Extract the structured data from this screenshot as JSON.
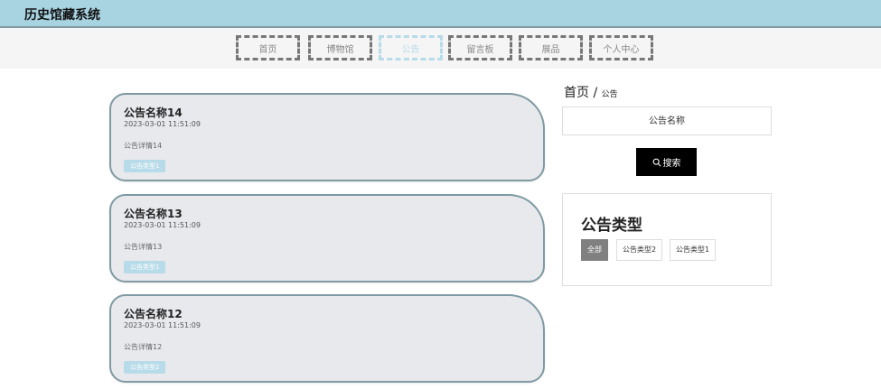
{
  "app": {
    "title": "历史馆藏系统"
  },
  "nav": {
    "items": [
      {
        "label": "首页",
        "active": false
      },
      {
        "label": "博物馆",
        "active": false
      },
      {
        "label": "公告",
        "active": true
      },
      {
        "label": "留言板",
        "active": false
      },
      {
        "label": "展品",
        "active": false
      },
      {
        "label": "个人中心",
        "active": false
      }
    ]
  },
  "notices": [
    {
      "title": "公告名称14",
      "time": "2023-03-01 11:51:09",
      "detail": "公告详情14",
      "tag": "公告类型1"
    },
    {
      "title": "公告名称13",
      "time": "2023-03-01 11:51:09",
      "detail": "公告详情13",
      "tag": "公告类型1"
    },
    {
      "title": "公告名称12",
      "time": "2023-03-01 11:51:09",
      "detail": "公告详情12",
      "tag": "公告类型2"
    }
  ],
  "breadcrumb": {
    "home": "首页",
    "separator": " / ",
    "current": "公告"
  },
  "search": {
    "placeholder": "公告名称",
    "button_label": "搜索"
  },
  "types": {
    "heading": "公告类型",
    "options": [
      {
        "label": "全部",
        "active": true
      },
      {
        "label": "公告类型2",
        "active": false
      },
      {
        "label": "公告类型1",
        "active": false
      }
    ]
  },
  "colors": {
    "header": "#a8d4e2",
    "accent": "#b7dbe8",
    "card": "#e8e9ed"
  }
}
